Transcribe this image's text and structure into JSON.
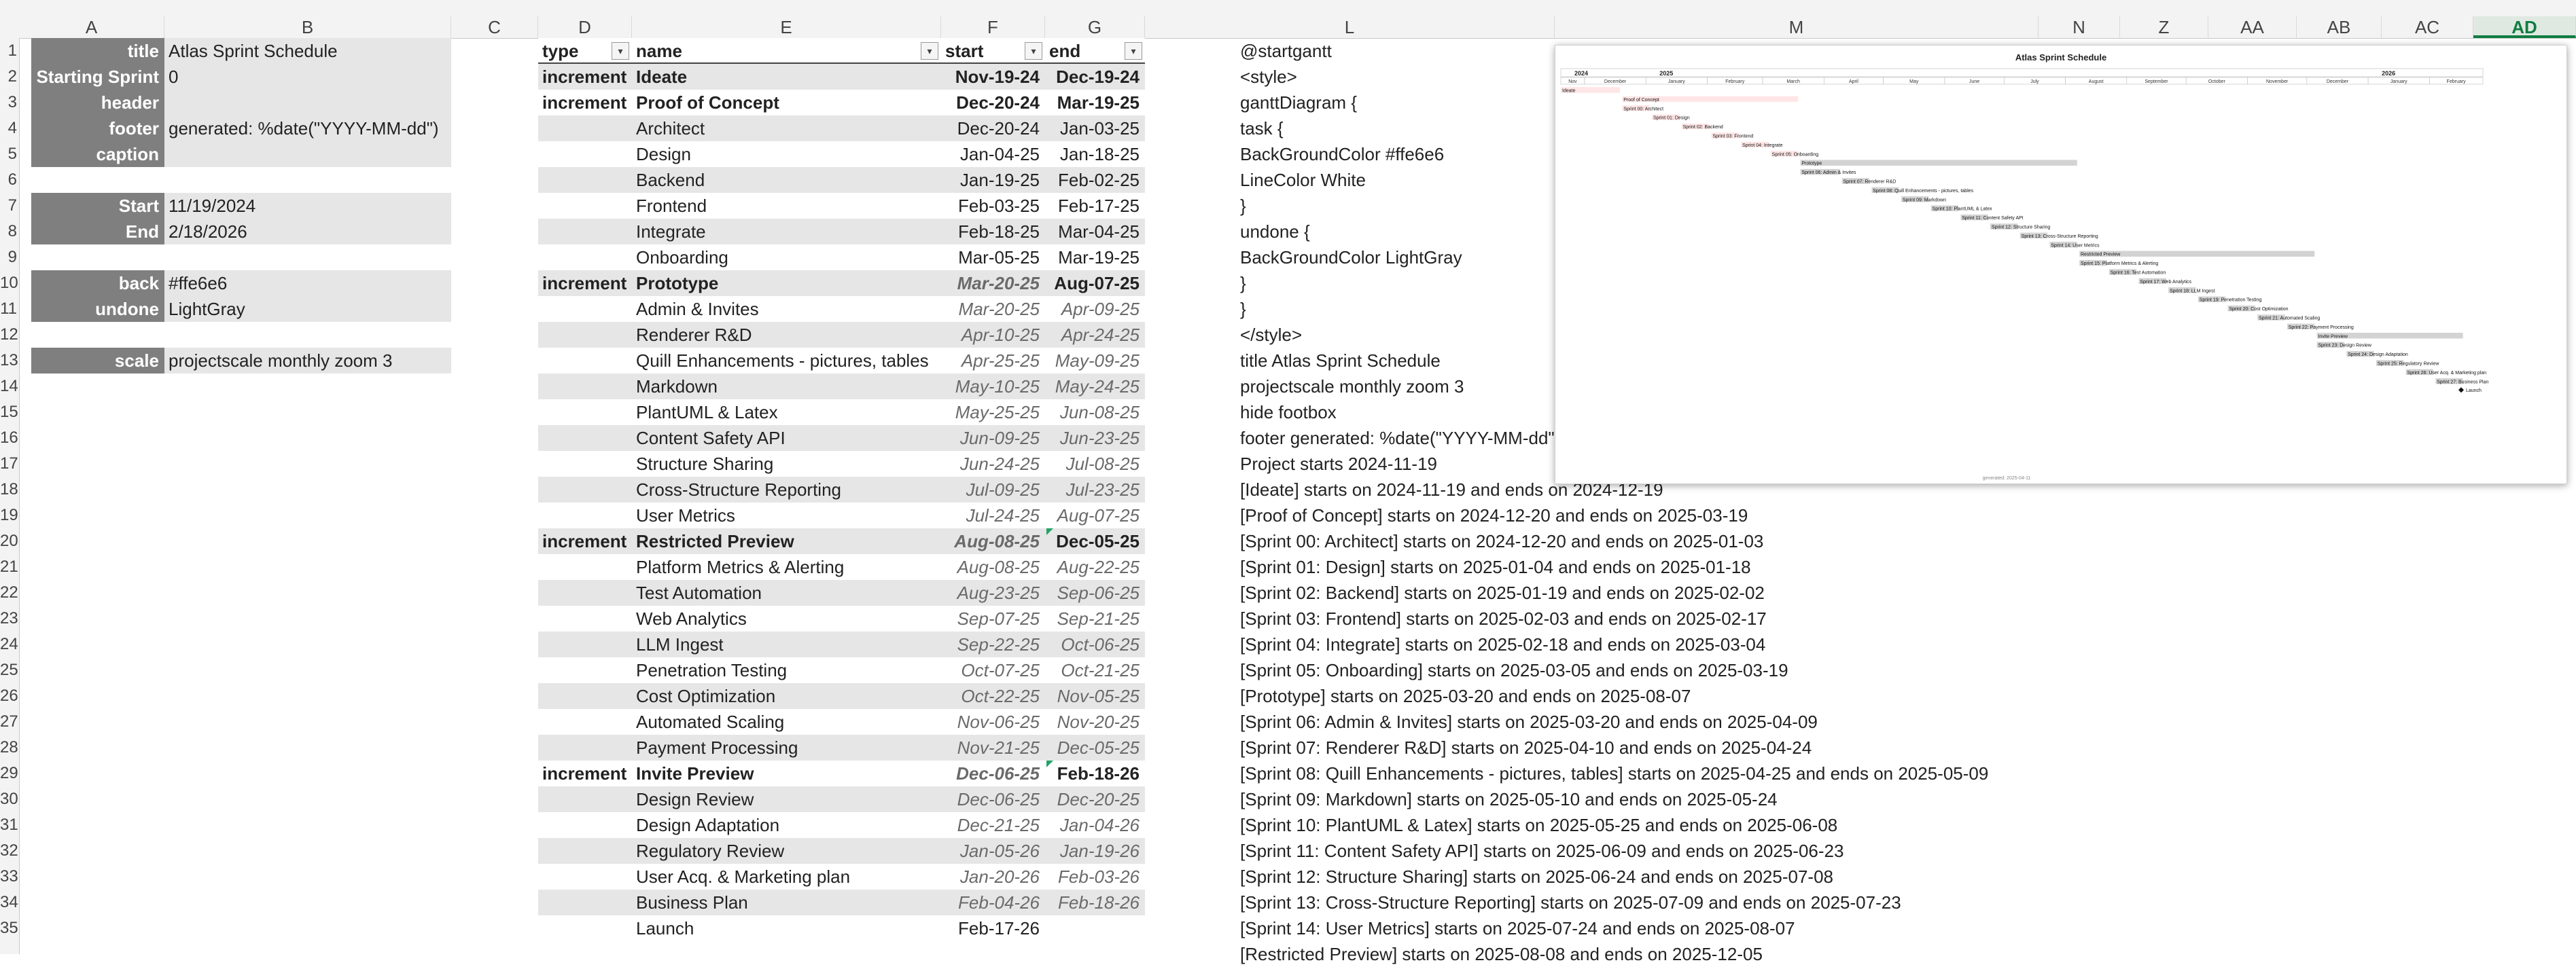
{
  "columns": [
    "A",
    "B",
    "C",
    "D",
    "E",
    "F",
    "G",
    "L",
    "M",
    "N",
    "Z",
    "AA",
    "AB",
    "AC",
    "AD"
  ],
  "active_column": "AD",
  "rows": [
    "1",
    "2",
    "3",
    "4",
    "5",
    "6",
    "7",
    "8",
    "9",
    "10",
    "11",
    "12",
    "13",
    "14",
    "15",
    "16",
    "17",
    "18",
    "19",
    "20",
    "21",
    "22",
    "23",
    "24",
    "25",
    "26",
    "27",
    "28",
    "29",
    "30",
    "31",
    "32",
    "33",
    "34",
    "35"
  ],
  "settings": [
    {
      "label": "title",
      "value": "Atlas Sprint Schedule"
    },
    {
      "label": "Starting Sprint",
      "value": "0"
    },
    {
      "label": "header",
      "value": ""
    },
    {
      "label": "footer",
      "value": "generated: %date(\"YYYY-MM-dd\")"
    },
    {
      "label": "caption",
      "value": ""
    },
    {
      "label": "",
      "value": ""
    },
    {
      "label": "Start",
      "value": "11/19/2024"
    },
    {
      "label": "End",
      "value": "2/18/2026"
    },
    {
      "label": "",
      "value": ""
    },
    {
      "label": "back",
      "value": "#ffe6e6"
    },
    {
      "label": "undone",
      "value": "LightGray"
    },
    {
      "label": "",
      "value": ""
    },
    {
      "label": "scale",
      "value": "projectscale monthly zoom 3"
    }
  ],
  "table": {
    "headers": {
      "type": "type",
      "name": "name",
      "start": "start",
      "end": "end"
    },
    "rows": [
      {
        "type": "increment",
        "name": "Ideate",
        "start": "Nov-19-24",
        "end": "Dec-19-24"
      },
      {
        "type": "increment",
        "name": "Proof of Concept",
        "start": "Dec-20-24",
        "end": "Mar-19-25"
      },
      {
        "type": "",
        "name": "Architect",
        "start": "Dec-20-24",
        "end": "Jan-03-25"
      },
      {
        "type": "",
        "name": "Design",
        "start": "Jan-04-25",
        "end": "Jan-18-25"
      },
      {
        "type": "",
        "name": "Backend",
        "start": "Jan-19-25",
        "end": "Feb-02-25"
      },
      {
        "type": "",
        "name": "Frontend",
        "start": "Feb-03-25",
        "end": "Feb-17-25"
      },
      {
        "type": "",
        "name": "Integrate",
        "start": "Feb-18-25",
        "end": "Mar-04-25"
      },
      {
        "type": "",
        "name": "Onboarding",
        "start": "Mar-05-25",
        "end": "Mar-19-25"
      },
      {
        "type": "increment",
        "name": "Prototype",
        "start": "Mar-20-25",
        "end": "Aug-07-25"
      },
      {
        "type": "",
        "name": "Admin & Invites",
        "start": "Mar-20-25",
        "end": "Apr-09-25"
      },
      {
        "type": "",
        "name": "Renderer R&D",
        "start": "Apr-10-25",
        "end": "Apr-24-25"
      },
      {
        "type": "",
        "name": "Quill Enhancements - pictures, tables",
        "start": "Apr-25-25",
        "end": "May-09-25"
      },
      {
        "type": "",
        "name": "Markdown",
        "start": "May-10-25",
        "end": "May-24-25"
      },
      {
        "type": "",
        "name": "PlantUML & Latex",
        "start": "May-25-25",
        "end": "Jun-08-25"
      },
      {
        "type": "",
        "name": "Content Safety API",
        "start": "Jun-09-25",
        "end": "Jun-23-25"
      },
      {
        "type": "",
        "name": "Structure Sharing",
        "start": "Jun-24-25",
        "end": "Jul-08-25"
      },
      {
        "type": "",
        "name": "Cross-Structure Reporting",
        "start": "Jul-09-25",
        "end": "Jul-23-25"
      },
      {
        "type": "",
        "name": "User Metrics",
        "start": "Jul-24-25",
        "end": "Aug-07-25"
      },
      {
        "type": "increment",
        "name": "Restricted Preview",
        "start": "Aug-08-25",
        "end": "Dec-05-25"
      },
      {
        "type": "",
        "name": "Platform Metrics & Alerting",
        "start": "Aug-08-25",
        "end": "Aug-22-25"
      },
      {
        "type": "",
        "name": "Test Automation",
        "start": "Aug-23-25",
        "end": "Sep-06-25"
      },
      {
        "type": "",
        "name": "Web Analytics",
        "start": "Sep-07-25",
        "end": "Sep-21-25"
      },
      {
        "type": "",
        "name": "LLM Ingest",
        "start": "Sep-22-25",
        "end": "Oct-06-25"
      },
      {
        "type": "",
        "name": "Penetration Testing",
        "start": "Oct-07-25",
        "end": "Oct-21-25"
      },
      {
        "type": "",
        "name": "Cost Optimization",
        "start": "Oct-22-25",
        "end": "Nov-05-25"
      },
      {
        "type": "",
        "name": "Automated Scaling",
        "start": "Nov-06-25",
        "end": "Nov-20-25"
      },
      {
        "type": "",
        "name": "Payment Processing",
        "start": "Nov-21-25",
        "end": "Dec-05-25"
      },
      {
        "type": "increment",
        "name": "Invite Preview",
        "start": "Dec-06-25",
        "end": "Feb-18-26"
      },
      {
        "type": "",
        "name": "Design Review",
        "start": "Dec-06-25",
        "end": "Dec-20-25"
      },
      {
        "type": "",
        "name": "Design Adaptation",
        "start": "Dec-21-25",
        "end": "Jan-04-26"
      },
      {
        "type": "",
        "name": "Regulatory Review",
        "start": "Jan-05-26",
        "end": "Jan-19-26"
      },
      {
        "type": "",
        "name": "User Acq. & Marketing plan",
        "start": "Jan-20-26",
        "end": "Feb-03-26"
      },
      {
        "type": "",
        "name": "Business Plan",
        "start": "Feb-04-26",
        "end": "Feb-18-26"
      },
      {
        "type": "",
        "name": "Launch",
        "start": "Feb-17-26",
        "end": ""
      }
    ]
  },
  "plantuml_lines": [
    "@startgantt",
    "<style>",
    "ganttDiagram {",
    "task {",
    "BackGroundColor #ffe6e6",
    "LineColor White",
    "}",
    "undone {",
    "BackGroundColor LightGray",
    "}",
    "}",
    "</style>",
    "title Atlas Sprint Schedule",
    "projectscale monthly zoom 3",
    "hide footbox",
    "footer generated: %date(\"YYYY-MM-dd\")",
    "Project starts 2024-11-19",
    "[Ideate] starts on 2024-11-19 and ends on 2024-12-19",
    "[Proof of Concept] starts on 2024-12-20 and ends on 2025-03-19",
    "[Sprint 00: Architect] starts on 2024-12-20 and ends on 2025-01-03",
    "[Sprint 01: Design] starts on 2025-01-04 and ends on 2025-01-18",
    "[Sprint 02: Backend] starts on 2025-01-19 and ends on 2025-02-02",
    "[Sprint 03: Frontend] starts on 2025-02-03 and ends on 2025-02-17",
    "[Sprint 04: Integrate] starts on 2025-02-18 and ends on 2025-03-04",
    "[Sprint 05: Onboarding] starts on 2025-03-05 and ends on 2025-03-19",
    "[Prototype] starts on 2025-03-20 and ends on 2025-08-07",
    "[Sprint 06: Admin & Invites] starts on 2025-03-20 and ends on 2025-04-09",
    "[Sprint 07: Renderer R&D] starts on 2025-04-10 and ends on 2025-04-24",
    "[Sprint 08: Quill Enhancements - pictures, tables] starts on 2025-04-25 and ends on 2025-05-09",
    "[Sprint 09: Markdown] starts on 2025-05-10 and ends on 2025-05-24",
    "[Sprint 10: PlantUML & Latex] starts on 2025-05-25 and ends on 2025-06-08",
    "[Sprint 11: Content Safety API] starts on 2025-06-09 and ends on 2025-06-23",
    "[Sprint 12: Structure Sharing] starts on 2025-06-24 and ends on 2025-07-08",
    "[Sprint 13: Cross-Structure Reporting] starts on 2025-07-09 and ends on 2025-07-23",
    "[Sprint 14: User Metrics] starts on 2025-07-24 and ends on 2025-08-07",
    "[Restricted Preview] starts on 2025-08-08 and ends on 2025-12-05"
  ],
  "gantt": {
    "title": "Atlas Sprint Schedule",
    "footer": "generated: 2025-04-11",
    "years": [
      "2024",
      "2025",
      "2026"
    ],
    "months": [
      "Nov",
      "December",
      "January",
      "February",
      "March",
      "April",
      "May",
      "June",
      "July",
      "August",
      "September",
      "October",
      "November",
      "December",
      "January",
      "February"
    ],
    "colors": {
      "task": "#ffe6e6",
      "undone": "#d3d3d3",
      "line": "#ffffff"
    },
    "tasks": [
      {
        "label": "Ideate",
        "start": "2024-11-19",
        "end": "2024-12-19"
      },
      {
        "label": "Proof of Concept",
        "start": "2024-12-20",
        "end": "2025-03-19"
      },
      {
        "label": "Sprint 00: Architect",
        "start": "2024-12-20",
        "end": "2025-01-03"
      },
      {
        "label": "Sprint 01: Design",
        "start": "2025-01-04",
        "end": "2025-01-18"
      },
      {
        "label": "Sprint 02: Backend",
        "start": "2025-01-19",
        "end": "2025-02-02"
      },
      {
        "label": "Sprint 03: Frontend",
        "start": "2025-02-03",
        "end": "2025-02-17"
      },
      {
        "label": "Sprint 04: Integrate",
        "start": "2025-02-18",
        "end": "2025-03-04"
      },
      {
        "label": "Sprint 05: Onboarding",
        "start": "2025-03-05",
        "end": "2025-03-19"
      },
      {
        "label": "Prototype",
        "start": "2025-03-20",
        "end": "2025-08-07"
      },
      {
        "label": "Sprint 06: Admin & Invites",
        "start": "2025-03-20",
        "end": "2025-04-09"
      },
      {
        "label": "Sprint 07: Renderer R&D",
        "start": "2025-04-10",
        "end": "2025-04-24"
      },
      {
        "label": "Sprint 08: Quill Enhancements - pictures, tables",
        "start": "2025-04-25",
        "end": "2025-05-09"
      },
      {
        "label": "Sprint 09: Markdown",
        "start": "2025-05-10",
        "end": "2025-05-24"
      },
      {
        "label": "Sprint 10: PlantUML & Latex",
        "start": "2025-05-25",
        "end": "2025-06-08"
      },
      {
        "label": "Sprint 11: Content Safety API",
        "start": "2025-06-09",
        "end": "2025-06-23"
      },
      {
        "label": "Sprint 12: Structure Sharing",
        "start": "2025-06-24",
        "end": "2025-07-08"
      },
      {
        "label": "Sprint 13: Cross-Structure Reporting",
        "start": "2025-07-09",
        "end": "2025-07-23"
      },
      {
        "label": "Sprint 14: User Metrics",
        "start": "2025-07-24",
        "end": "2025-08-07"
      },
      {
        "label": "Restricted Preview",
        "start": "2025-08-08",
        "end": "2025-12-05"
      },
      {
        "label": "Sprint 15: Platform Metrics & Alerting",
        "start": "2025-08-08",
        "end": "2025-08-22"
      },
      {
        "label": "Sprint 16: Test Automation",
        "start": "2025-08-23",
        "end": "2025-09-06"
      },
      {
        "label": "Sprint 17: Web Analytics",
        "start": "2025-09-07",
        "end": "2025-09-21"
      },
      {
        "label": "Sprint 18: LLM Ingest",
        "start": "2025-09-22",
        "end": "2025-10-06"
      },
      {
        "label": "Sprint 19: Penetration Testing",
        "start": "2025-10-07",
        "end": "2025-10-21"
      },
      {
        "label": "Sprint 20: Cost Optimization",
        "start": "2025-10-22",
        "end": "2025-11-05"
      },
      {
        "label": "Sprint 21: Automated Scaling",
        "start": "2025-11-06",
        "end": "2025-11-20"
      },
      {
        "label": "Sprint 22: Payment Processing",
        "start": "2025-11-21",
        "end": "2025-12-05"
      },
      {
        "label": "Invite Preview",
        "start": "2025-12-06",
        "end": "2026-02-18"
      },
      {
        "label": "Sprint 23: Design Review",
        "start": "2025-12-06",
        "end": "2025-12-20"
      },
      {
        "label": "Sprint 24: Design Adaptation",
        "start": "2025-12-21",
        "end": "2026-01-04"
      },
      {
        "label": "Sprint 25: Regulatory Review",
        "start": "2026-01-05",
        "end": "2026-01-19"
      },
      {
        "label": "Sprint 26: User Acq. & Marketing plan",
        "start": "2026-01-20",
        "end": "2026-02-03"
      },
      {
        "label": "Sprint 27: Business Plan",
        "start": "2026-02-04",
        "end": "2026-02-18"
      }
    ],
    "milestone": {
      "label": "Launch",
      "date": "2026-02-17"
    },
    "range": {
      "start": "2024-11-19",
      "end": "2026-02-28"
    }
  }
}
